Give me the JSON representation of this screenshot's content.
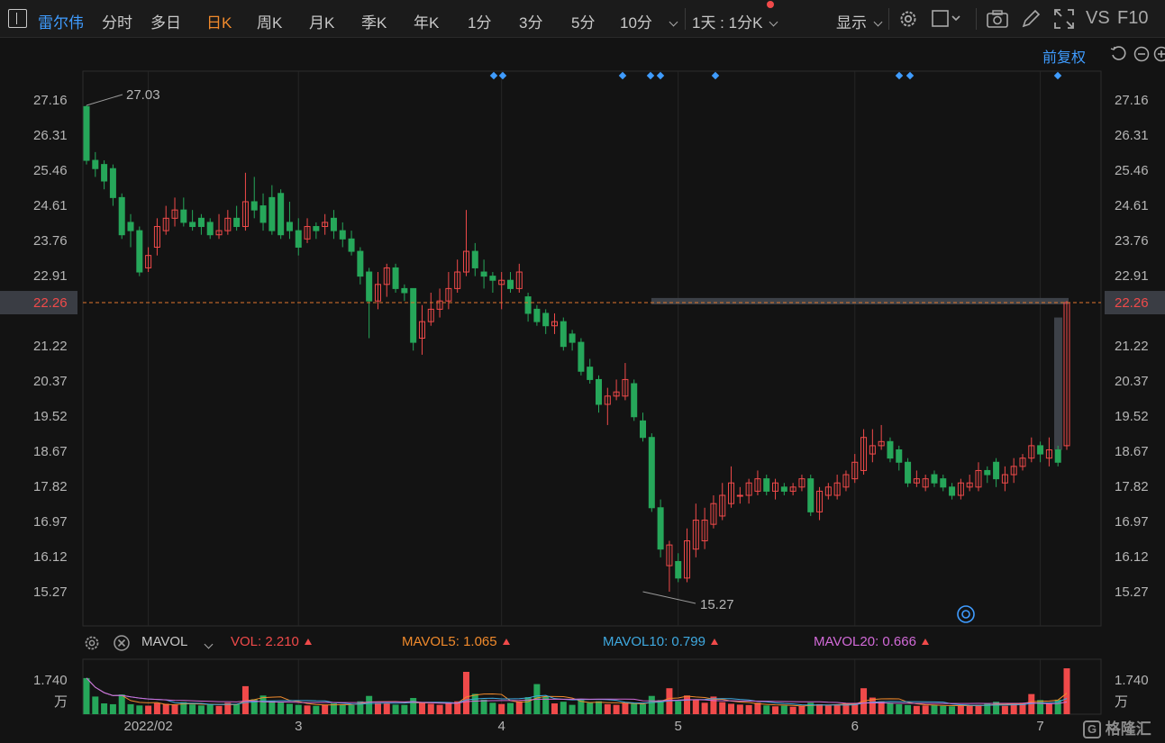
{
  "toolbar": {
    "stock_name": "雷尔伟",
    "periods": [
      "分时",
      "多日",
      "日K",
      "周K",
      "月K",
      "季K",
      "年K",
      "1分",
      "3分",
      "5分",
      "10分"
    ],
    "active_period": "日K",
    "interval": "1天 : 1分K",
    "display": "显示",
    "vs": "VS",
    "f10": "F10"
  },
  "chart_controls": {
    "adjust": "前复权"
  },
  "volume_panel": {
    "indicator": "MAVOL",
    "vol_label": "VOL: 2.210",
    "mavol5_label": "MAVOL5: 1.065",
    "mavol10_label": "MAVOL10: 0.799",
    "mavol20_label": "MAVOL20: 0.666",
    "axis_value": "1.740",
    "axis_unit": "万"
  },
  "brand": "格隆汇",
  "colors": {
    "up": "#f04a4a",
    "down": "#26a75a",
    "ma5": "#f08a2c",
    "ma10": "#3fa9e0",
    "ma20": "#d26ad8",
    "last_line": "#e0762c",
    "accent": "#3f9cff"
  },
  "chart_data": {
    "type": "candlestick",
    "y_ticks": [
      27.16,
      26.31,
      25.46,
      24.61,
      23.76,
      22.91,
      22.26,
      21.22,
      20.37,
      19.52,
      18.67,
      17.82,
      16.97,
      16.12,
      15.27
    ],
    "ylim": [
      15.27,
      27.16
    ],
    "x_labels": [
      "2022/02",
      "3",
      "4",
      "5",
      "6",
      "7"
    ],
    "x_label_candle_index": [
      7,
      24,
      47,
      67,
      87,
      108
    ],
    "max_label": "27.03",
    "max_index": 0,
    "min_label": "15.27",
    "min_index": 63,
    "last_price": 22.26,
    "candles": [
      [
        27.0,
        25.7,
        27.03,
        25.6
      ],
      [
        25.7,
        25.5,
        25.9,
        25.3
      ],
      [
        25.6,
        25.2,
        25.7,
        25.0
      ],
      [
        25.5,
        24.8,
        25.6,
        24.6
      ],
      [
        24.8,
        23.9,
        24.9,
        23.8
      ],
      [
        24.2,
        24.0,
        24.4,
        23.6
      ],
      [
        24.0,
        23.0,
        24.1,
        22.9
      ],
      [
        23.1,
        23.4,
        23.6,
        23.0
      ],
      [
        23.6,
        24.1,
        24.3,
        23.4
      ],
      [
        24.0,
        24.3,
        24.6,
        23.9
      ],
      [
        24.3,
        24.5,
        24.8,
        24.1
      ],
      [
        24.5,
        24.2,
        24.8,
        24.1
      ],
      [
        24.2,
        24.1,
        24.5,
        24.0
      ],
      [
        24.3,
        24.1,
        24.4,
        23.9
      ],
      [
        24.2,
        23.9,
        24.3,
        23.8
      ],
      [
        23.9,
        24.0,
        24.4,
        23.8
      ],
      [
        24.0,
        24.3,
        24.5,
        23.9
      ],
      [
        24.3,
        24.1,
        24.6,
        24.0
      ],
      [
        24.1,
        24.7,
        25.4,
        24.0
      ],
      [
        24.7,
        24.5,
        25.3,
        24.3
      ],
      [
        24.6,
        24.2,
        24.9,
        24.0
      ],
      [
        24.8,
        24.0,
        25.1,
        23.9
      ],
      [
        24.9,
        23.9,
        25.0,
        23.8
      ],
      [
        24.2,
        24.0,
        24.7,
        23.8
      ],
      [
        24.0,
        23.6,
        24.3,
        23.4
      ],
      [
        23.8,
        24.1,
        24.3,
        23.7
      ],
      [
        24.1,
        24.0,
        24.2,
        23.8
      ],
      [
        24.1,
        24.2,
        24.4,
        23.9
      ],
      [
        24.3,
        24.0,
        24.5,
        23.8
      ],
      [
        24.0,
        23.8,
        24.2,
        23.6
      ],
      [
        23.8,
        23.5,
        24.0,
        23.4
      ],
      [
        23.5,
        22.9,
        23.6,
        22.7
      ],
      [
        23.0,
        22.3,
        23.1,
        21.4
      ],
      [
        22.3,
        22.7,
        23.0,
        22.1
      ],
      [
        22.7,
        23.1,
        23.2,
        22.4
      ],
      [
        23.1,
        22.6,
        23.2,
        22.5
      ],
      [
        22.6,
        22.5,
        22.7,
        22.3
      ],
      [
        22.6,
        21.3,
        22.6,
        21.1
      ],
      [
        21.4,
        21.8,
        22.2,
        21.0
      ],
      [
        21.8,
        22.1,
        22.5,
        21.7
      ],
      [
        22.1,
        22.3,
        22.6,
        21.9
      ],
      [
        22.3,
        22.6,
        23.0,
        22.1
      ],
      [
        22.6,
        23.0,
        23.3,
        22.5
      ],
      [
        23.0,
        23.5,
        24.5,
        22.9
      ],
      [
        23.5,
        23.1,
        23.7,
        22.9
      ],
      [
        23.0,
        22.9,
        23.3,
        22.6
      ],
      [
        22.9,
        22.8,
        23.0,
        22.5
      ],
      [
        22.7,
        22.8,
        23.0,
        22.1
      ],
      [
        22.8,
        22.6,
        23.0,
        22.5
      ],
      [
        22.6,
        23.0,
        23.2,
        22.5
      ],
      [
        22.4,
        22.0,
        22.5,
        21.8
      ],
      [
        22.1,
        21.8,
        22.2,
        21.7
      ],
      [
        22.0,
        21.7,
        22.1,
        21.5
      ],
      [
        21.7,
        21.8,
        22.0,
        21.5
      ],
      [
        21.8,
        21.2,
        21.9,
        21.1
      ],
      [
        21.5,
        21.3,
        21.6,
        21.1
      ],
      [
        21.3,
        20.6,
        21.4,
        20.5
      ],
      [
        20.7,
        20.4,
        20.9,
        20.3
      ],
      [
        20.4,
        19.8,
        20.5,
        19.6
      ],
      [
        19.8,
        20.0,
        20.2,
        19.3
      ],
      [
        20.0,
        20.1,
        20.4,
        19.9
      ],
      [
        20.0,
        20.4,
        20.8,
        19.9
      ],
      [
        20.3,
        19.5,
        20.4,
        19.4
      ],
      [
        19.4,
        19.0,
        19.6,
        18.9
      ],
      [
        19.0,
        17.3,
        19.1,
        17.2
      ],
      [
        17.3,
        16.3,
        17.5,
        16.1
      ],
      [
        15.9,
        16.4,
        16.5,
        15.27
      ],
      [
        16.0,
        15.6,
        16.2,
        15.5
      ],
      [
        15.6,
        16.5,
        16.8,
        15.5
      ],
      [
        16.3,
        17.0,
        17.4,
        16.1
      ],
      [
        16.5,
        17.0,
        17.3,
        16.3
      ],
      [
        16.9,
        17.4,
        17.6,
        16.8
      ],
      [
        17.1,
        17.6,
        17.9,
        17.0
      ],
      [
        17.4,
        17.9,
        18.3,
        17.3
      ],
      [
        17.6,
        17.6,
        17.8,
        17.4
      ],
      [
        17.6,
        17.9,
        18.0,
        17.4
      ],
      [
        17.7,
        18.0,
        18.2,
        17.6
      ],
      [
        18.0,
        17.7,
        18.1,
        17.6
      ],
      [
        17.7,
        17.9,
        18.0,
        17.5
      ],
      [
        17.8,
        17.7,
        17.9,
        17.6
      ],
      [
        17.7,
        17.8,
        17.9,
        17.6
      ],
      [
        17.8,
        18.0,
        18.1,
        17.7
      ],
      [
        18.0,
        17.2,
        18.1,
        17.1
      ],
      [
        17.2,
        17.7,
        17.8,
        17.0
      ],
      [
        17.6,
        17.8,
        17.9,
        17.5
      ],
      [
        17.6,
        17.9,
        18.1,
        17.5
      ],
      [
        17.8,
        18.1,
        18.2,
        17.7
      ],
      [
        18.0,
        18.4,
        18.6,
        17.9
      ],
      [
        18.2,
        19.0,
        19.2,
        18.1
      ],
      [
        18.6,
        18.8,
        19.2,
        18.4
      ],
      [
        18.8,
        18.9,
        19.3,
        18.7
      ],
      [
        18.9,
        18.5,
        19.0,
        18.4
      ],
      [
        18.7,
        18.4,
        18.8,
        18.2
      ],
      [
        18.4,
        17.9,
        18.5,
        17.8
      ],
      [
        17.9,
        18.0,
        18.2,
        17.8
      ],
      [
        17.8,
        18.0,
        18.1,
        17.7
      ],
      [
        18.1,
        17.9,
        18.2,
        17.8
      ],
      [
        18.0,
        17.8,
        18.1,
        17.7
      ],
      [
        17.8,
        17.6,
        17.9,
        17.5
      ],
      [
        17.6,
        17.9,
        18.0,
        17.5
      ],
      [
        17.8,
        17.9,
        18.1,
        17.7
      ],
      [
        17.8,
        18.2,
        18.4,
        17.7
      ],
      [
        18.2,
        18.1,
        18.3,
        17.9
      ],
      [
        18.4,
        18.0,
        18.5,
        17.8
      ],
      [
        17.9,
        18.1,
        18.3,
        17.7
      ],
      [
        18.1,
        18.3,
        18.5,
        17.9
      ],
      [
        18.3,
        18.5,
        18.6,
        18.2
      ],
      [
        18.5,
        18.8,
        19.0,
        18.4
      ],
      [
        18.8,
        18.6,
        18.9,
        18.4
      ],
      [
        18.5,
        18.7,
        19.0,
        18.3
      ],
      [
        18.7,
        18.4,
        18.8,
        18.3
      ],
      [
        18.8,
        22.26,
        22.3,
        18.7
      ]
    ],
    "volumes": [
      1.74,
      0.85,
      0.52,
      0.48,
      0.95,
      0.48,
      0.42,
      0.41,
      0.53,
      0.5,
      0.45,
      0.58,
      0.47,
      0.42,
      0.46,
      0.4,
      0.55,
      0.48,
      1.35,
      0.72,
      0.9,
      0.65,
      0.56,
      0.5,
      0.45,
      0.42,
      0.4,
      0.46,
      0.52,
      0.48,
      0.44,
      0.62,
      0.88,
      0.55,
      0.52,
      0.46,
      0.45,
      0.78,
      0.54,
      0.5,
      0.45,
      0.52,
      0.62,
      2.04,
      0.98,
      0.7,
      0.55,
      0.49,
      0.54,
      0.62,
      0.82,
      1.45,
      0.85,
      0.52,
      0.6,
      0.45,
      0.68,
      0.55,
      0.62,
      0.48,
      0.45,
      0.55,
      0.5,
      0.48,
      0.88,
      0.68,
      1.25,
      0.62,
      0.9,
      0.7,
      0.55,
      0.85,
      0.58,
      0.5,
      0.46,
      0.44,
      0.55,
      0.42,
      0.38,
      0.41,
      0.36,
      0.4,
      0.55,
      0.48,
      0.42,
      0.46,
      0.52,
      0.5,
      1.25,
      0.8,
      0.62,
      0.55,
      0.48,
      0.44,
      0.4,
      0.42,
      0.45,
      0.4,
      0.38,
      0.42,
      0.4,
      0.45,
      0.5,
      0.6,
      0.4,
      0.48,
      0.55,
      0.97,
      0.68,
      0.5,
      0.7,
      2.21
    ]
  }
}
